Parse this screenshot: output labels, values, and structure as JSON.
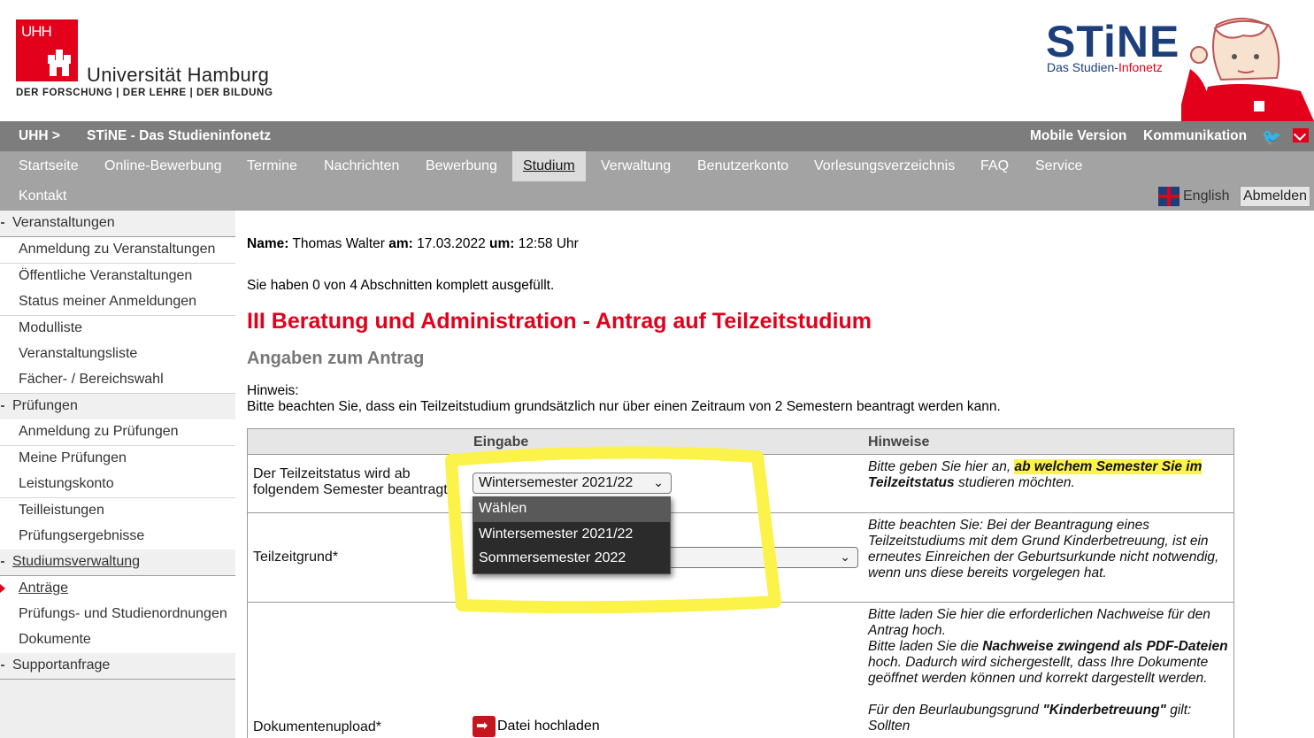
{
  "header": {
    "uni_logo_text": "UHH",
    "uni_name": "Universität Hamburg",
    "uni_tagline": "DER FORSCHUNG | DER LEHRE | DER BILDUNG",
    "app_logo": "STiNE",
    "app_subtitle_a": "Das Studien-",
    "app_subtitle_b": "Infonetz"
  },
  "topbar": {
    "breadcrumb_home": "UHH >",
    "breadcrumb_app": "STiNE - Das Studieninfonetz",
    "mobile": "Mobile Version",
    "kommunikation": "Kommunikation",
    "twitter_icon": "twitter-icon",
    "mail_icon": "mail-icon"
  },
  "nav": {
    "items": [
      "Startseite",
      "Online-Bewerbung",
      "Termine",
      "Nachrichten",
      "Bewerbung",
      "Studium",
      "Verwaltung",
      "Benutzerkonto",
      "Vorlesungsverzeichnis",
      "FAQ",
      "Service"
    ],
    "active": "Studium",
    "row2": "Kontakt",
    "language": "English",
    "logout": "Abmelden"
  },
  "sidebar": {
    "items": [
      {
        "label": "Veranstaltungen",
        "type": "section"
      },
      {
        "label": "Anmeldung zu Veranstaltungen",
        "type": "sub"
      },
      {
        "label": "Öffentliche Veranstaltungen",
        "type": "sub"
      },
      {
        "label": "Status meiner Anmeldungen",
        "type": "sub"
      },
      {
        "label": "Modulliste",
        "type": "sub"
      },
      {
        "label": "Veranstaltungsliste",
        "type": "sub"
      },
      {
        "label": "Fächer- / Bereichswahl",
        "type": "sub"
      },
      {
        "label": "Prüfungen",
        "type": "section"
      },
      {
        "label": "Anmeldung zu Prüfungen",
        "type": "sub"
      },
      {
        "label": "Meine Prüfungen",
        "type": "sub"
      },
      {
        "label": "Leistungskonto",
        "type": "sub"
      },
      {
        "label": "Teilleistungen",
        "type": "sub"
      },
      {
        "label": "Prüfungsergebnisse",
        "type": "sub"
      },
      {
        "label": "Studiumsverwaltung",
        "type": "section"
      },
      {
        "label": "Anträge",
        "type": "sub"
      },
      {
        "label": "Prüfungs- und Studienordnungen",
        "type": "sub"
      },
      {
        "label": "Dokumente",
        "type": "sub"
      },
      {
        "label": "Supportanfrage",
        "type": "section"
      }
    ]
  },
  "main": {
    "name_label": "Name:",
    "name_value": "Thomas Walter",
    "date_label": "am:",
    "date_value": "17.03.2022",
    "time_label": "um:",
    "time_value": "12:58 Uhr",
    "progress": "Sie haben 0 von 4 Abschnitten komplett ausgefüllt.",
    "title": "III Beratung und Administration - Antrag auf Teilzeitstudium",
    "section": "Angaben zum Antrag",
    "hinweis_label": "Hinweis:",
    "hinweis_text": "Bitte beachten Sie, dass ein Teilzeitstudium grundsätzlich nur über einen Zeitraum von 2 Semestern beantragt werden kann.",
    "table": {
      "col_input": "Eingabe",
      "col_hints": "Hinweise",
      "row1_label_a": "Der Teilzeitstatus wird ab",
      "row1_label_b": "folgendem Semester beantragt*",
      "row1_select": "Wintersemester 2021/22",
      "row1_hint_a": "Bitte geben Sie hier an,",
      "row1_hint_b": "ab welchem Semester Sie im",
      "row1_hint_c": "Teilzeitstatus",
      "row1_hint_d": "studieren möchten.",
      "dropdown_options": [
        "Wählen",
        "Wintersemester 2021/22",
        "Sommersemester 2022"
      ],
      "row2_label": "Teilzeitgrund*",
      "row2_hint": "Bitte beachten Sie: Bei der Beantragung eines Teilzeitstudiums mit dem Grund Kinderbetreuung, ist ein erneutes Einreichen der Geburtsurkunde nicht notwendig, wenn uns diese bereits vorgelegen hat.",
      "row3_label": "Dokumentenupload*",
      "row3_upload": "Datei hochladen",
      "row3_hint_a": "Bitte laden Sie hier die erforderlichen Nachweise für den Antrag hoch.",
      "row3_hint_b1": "Bitte laden Sie die",
      "row3_hint_b2": "Nachweise zwingend als PDF-Dateien",
      "row3_hint_b3": "hoch. Dadurch wird sichergestellt, dass Ihre Dokumente geöffnet werden können und korrekt dargestellt werden.",
      "row3_hint_c1": "Für den Beurlaubungsgrund",
      "row3_hint_c2": "\"Kinderbetreuung\"",
      "row3_hint_c3": "gilt: Sollten"
    }
  },
  "colors": {
    "brand_red": "#e2001a",
    "brand_blue": "#1c3e7a",
    "annotation_yellow": "#fbf24a"
  }
}
